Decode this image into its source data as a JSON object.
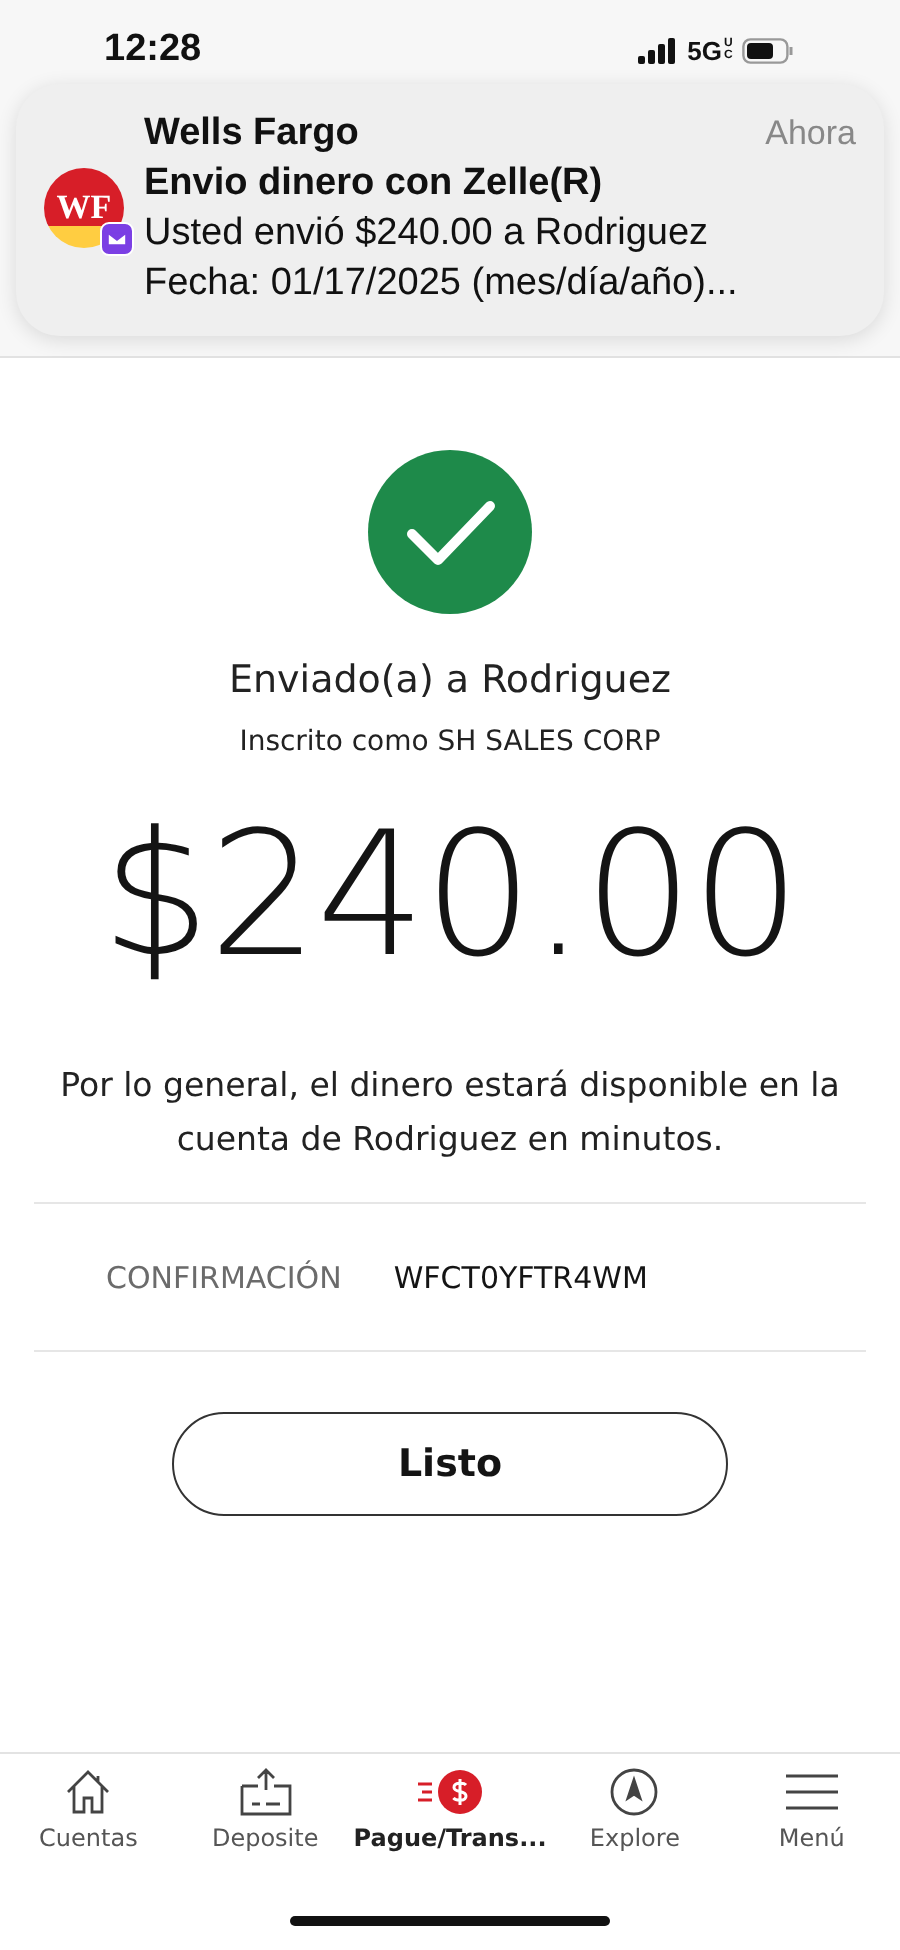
{
  "status_bar": {
    "time": "12:28",
    "network": "5G",
    "network_badge": "UC"
  },
  "notification": {
    "logo": "WF",
    "app": "Wells Fargo",
    "time": "Ahora",
    "title": "Envio dinero con Zelle(R)",
    "lines": [
      "Usted envió $240.00 a Rodriguez",
      "Fecha: 01/17/2025 (mes/día/año)..."
    ]
  },
  "success": {
    "heading": "Enviado(a) a Rodriguez",
    "subheading": "Inscrito como SH SALES CORP",
    "amount": "$240.00",
    "message": "Por lo general, el dinero estará disponible en la cuenta de Rodriguez en minutos."
  },
  "confirmation": {
    "label": "CONFIRMACIÓN",
    "value": "WFCT0YFTR4WM"
  },
  "done_button": "Listo",
  "nav": [
    {
      "kind": "home",
      "label": "Cuentas",
      "selected": false
    },
    {
      "kind": "deposit",
      "label": "Deposite",
      "selected": false
    },
    {
      "kind": "pay",
      "label": "Pague/Trans...",
      "selected": true
    },
    {
      "kind": "explore",
      "label": "Explore",
      "selected": false
    },
    {
      "kind": "menu",
      "label": "Menú",
      "selected": false
    }
  ]
}
